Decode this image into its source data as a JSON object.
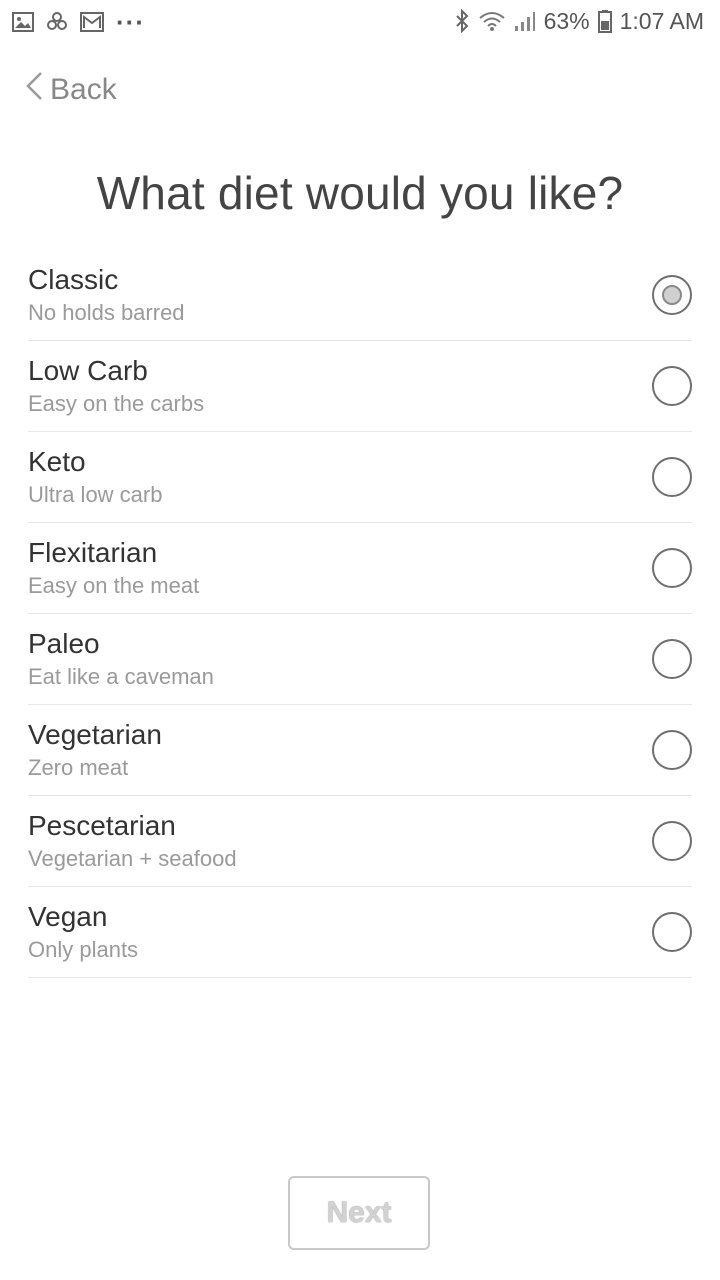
{
  "status_bar": {
    "icons_left": [
      "gallery-icon",
      "pinwheel-icon",
      "gmail-icon",
      "more-dots-icon"
    ],
    "more_dots": "···",
    "icons_right": [
      "bluetooth-icon",
      "wifi-icon",
      "signal-icon"
    ],
    "battery_percent": "63%",
    "time": "1:07 AM"
  },
  "header": {
    "back_label": "Back"
  },
  "title": "What diet would you like?",
  "diets": [
    {
      "name": "Classic",
      "description": "No holds barred",
      "selected": true
    },
    {
      "name": "Low Carb",
      "description": "Easy on the carbs",
      "selected": false
    },
    {
      "name": "Keto",
      "description": "Ultra low carb",
      "selected": false
    },
    {
      "name": "Flexitarian",
      "description": "Easy on the meat",
      "selected": false
    },
    {
      "name": "Paleo",
      "description": "Eat like a caveman",
      "selected": false
    },
    {
      "name": "Vegetarian",
      "description": "Zero meat",
      "selected": false
    },
    {
      "name": "Pescetarian",
      "description": "Vegetarian + seafood",
      "selected": false
    },
    {
      "name": "Vegan",
      "description": "Only plants",
      "selected": false
    }
  ],
  "footer": {
    "next_label": "Next"
  }
}
